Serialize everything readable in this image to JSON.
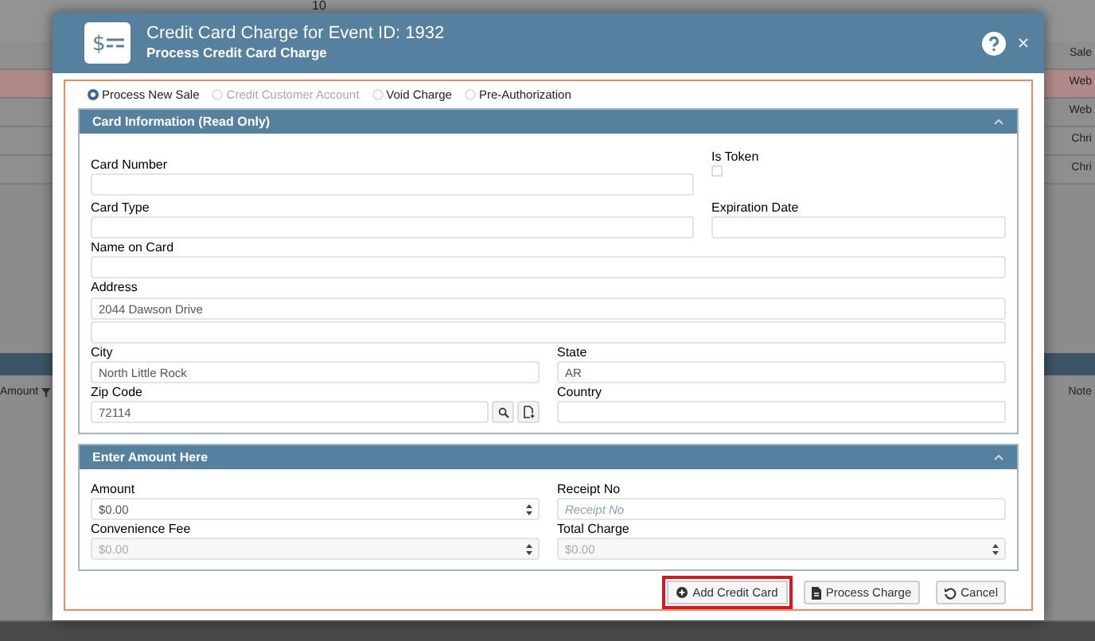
{
  "backdrop": {
    "top_text": "10",
    "right_rows": [
      {
        "text": "Sale",
        "selected": false
      },
      {
        "text": "Web",
        "selected": true
      },
      {
        "text": "Web",
        "selected": false
      },
      {
        "text": "Chri",
        "selected": false
      },
      {
        "text": "Chri",
        "selected": false
      }
    ],
    "left_header": "Amount",
    "right_header": "Note"
  },
  "dialog": {
    "icon_symbol": "$",
    "title": "Credit Card Charge for Event ID: 1932",
    "subtitle": "Process Credit Card Charge"
  },
  "radio_options": [
    {
      "label": "Process New Sale",
      "selected": true,
      "disabled": false
    },
    {
      "label": "Credit Customer Account",
      "selected": false,
      "disabled": true
    },
    {
      "label": "Void Charge",
      "selected": false,
      "disabled": false
    },
    {
      "label": "Pre-Authorization",
      "selected": false,
      "disabled": false
    }
  ],
  "card_panel": {
    "title": "Card Information (Read Only)",
    "expanded": true,
    "card_number": {
      "label": "Card Number"
    },
    "is_token": {
      "label": "Is Token",
      "checked": false
    },
    "card_type": {
      "label": "Card Type"
    },
    "expiration_date": {
      "label": "Expiration Date"
    },
    "name_on_card": {
      "label": "Name on Card"
    },
    "address": {
      "label": "Address",
      "line_1": "2044 Dawson Drive"
    },
    "city": {
      "label": "City",
      "value": "North Little Rock"
    },
    "state": {
      "label": "State",
      "value": "AR"
    },
    "zip_code": {
      "label": "Zip Code",
      "value": "72114"
    },
    "country": {
      "label": "Country"
    }
  },
  "amount_panel": {
    "title": "Enter Amount Here",
    "expanded": true,
    "amount": {
      "label": "Amount",
      "value": "$0.00",
      "disabled": false
    },
    "receipt_no": {
      "label": "Receipt No",
      "placeholder": "Receipt No"
    },
    "convenience_fee": {
      "label": "Convenience Fee",
      "value": "$0.00",
      "disabled": true
    },
    "total_charge": {
      "label": "Total Charge",
      "value": "$0.00",
      "disabled": true
    }
  },
  "buttons": [
    {
      "kind": "add",
      "label": "Add Credit Card",
      "highlighted": true
    },
    {
      "kind": "process",
      "label": "Process Charge",
      "highlighted": false
    },
    {
      "kind": "cancel",
      "label": "Cancel",
      "highlighted": false
    }
  ]
}
